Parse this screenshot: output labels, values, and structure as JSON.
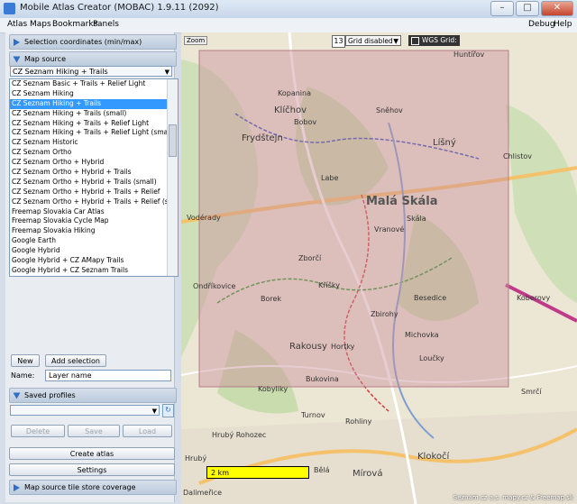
{
  "window": {
    "title": "Mobile Atlas Creator (MOBAC) 1.9.11 (2092)"
  },
  "menubar": {
    "left": [
      "Atlas",
      "Maps",
      "Bookmarks",
      "Panels"
    ],
    "right": [
      "Debug",
      "Help"
    ]
  },
  "sections": {
    "selection_coordinates": "Selection coordinates (min/max)",
    "map_source": "Map source",
    "saved_profiles": "Saved profiles",
    "tile_store": "Map source tile store coverage"
  },
  "map_source": {
    "selected": "CZ Seznam Hiking + Trails",
    "options": [
      "CZ Seznam Basic + Trails + Relief Light",
      "CZ Seznam Hiking",
      "CZ Seznam Hiking + Trails",
      "CZ Seznam Hiking + Trails (small)",
      "CZ Seznam Hiking + Trails + Relief Light",
      "CZ Seznam Hiking + Trails + Relief Light (small)",
      "CZ Seznam Historic",
      "CZ Seznam Ortho",
      "CZ Seznam Ortho + Hybrid",
      "CZ Seznam Ortho + Hybrid + Trails",
      "CZ Seznam Ortho + Hybrid + Trails (small)",
      "CZ Seznam Ortho + Hybrid + Trails + Relief",
      "CZ Seznam Ortho + Hybrid + Trails + Relief (small)",
      "Freemap Slovakia Car Atlas",
      "Freemap Slovakia Cycle Map",
      "Freemap Slovakia Hiking",
      "Google Earth",
      "Google Hybrid",
      "Google Hybrid + CZ AMapy Trails",
      "Google Hybrid + CZ Seznam Trails"
    ],
    "selected_index": 2
  },
  "layers": {
    "new": "New",
    "add_selection": "Add selection",
    "name_label": "Name:",
    "name_value": "Layer name"
  },
  "profiles": {
    "delete": "Delete",
    "save": "Save",
    "load": "Load"
  },
  "actions": {
    "create_atlas": "Create atlas",
    "settings": "Settings"
  },
  "map": {
    "zoom_label": "Zoom",
    "zoom_level": "13",
    "grid": "Grid disabled",
    "wgs": "WGS Grid:",
    "scale": "2 km",
    "copyright": "Seznam.cz a.s. mapy.cz & Freemap.sk",
    "places": [
      "Klíčhov",
      "Kopanina",
      "Bobov",
      "Frydštejn",
      "Labe",
      "Malá Skála",
      "Líšný",
      "Vranové",
      "Zborčí",
      "Rakousy",
      "Loučky",
      "Koberovy",
      "Kobyliky",
      "Hrubý Rohozec",
      "Turnov",
      "Mírová",
      "Klokočí",
      "Vodérady",
      "Ondříkovice",
      "Borek",
      "Kříšky",
      "Zbirohy",
      "Michovka",
      "Hortky",
      "Bukovina",
      "Rohliny",
      "Besedice",
      "Smrčí",
      "Chlistov",
      "Sněhov",
      "Huntířov",
      "Bělá",
      "Dalimeřice",
      "Hrubý",
      "Skála"
    ]
  },
  "colors": {
    "selection": "#c98f9b",
    "highlight": "#3399ff",
    "header": "#2f6fc2",
    "scalebar": "#ffff00"
  }
}
